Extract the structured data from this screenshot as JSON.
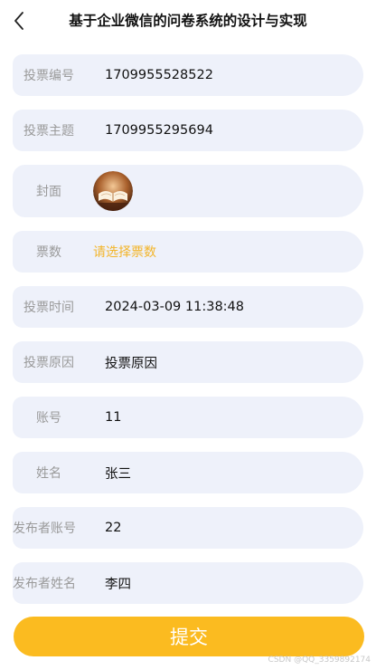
{
  "header": {
    "title": "基于企业微信的问卷系统的设计与实现",
    "back_icon": "chevron-left-icon"
  },
  "form": {
    "vote_number": {
      "label": "投票编号",
      "value": "1709955528522"
    },
    "vote_topic": {
      "label": "投票主题",
      "value": "1709955295694"
    },
    "cover": {
      "label": "封面",
      "image": "book-cover-thumbnail"
    },
    "votes": {
      "label": "票数",
      "placeholder": "请选择票数"
    },
    "vote_time": {
      "label": "投票时间",
      "value": "2024-03-09 11:38:48"
    },
    "vote_reason": {
      "label": "投票原因",
      "value": "投票原因"
    },
    "account": {
      "label": "账号",
      "value": "11"
    },
    "name": {
      "label": "姓名",
      "value": "张三"
    },
    "publisher_account": {
      "label": "发布者账号",
      "value": "22"
    },
    "publisher_name": {
      "label": "发布者姓名",
      "value": "李四"
    }
  },
  "submit": {
    "label": "提交"
  },
  "watermark": "CSDN @QQ_3359892174",
  "colors": {
    "row_background": "#eef1fa",
    "label": "#9a9a9a",
    "accent": "#fbbb20",
    "placeholder": "#f3b52a"
  }
}
